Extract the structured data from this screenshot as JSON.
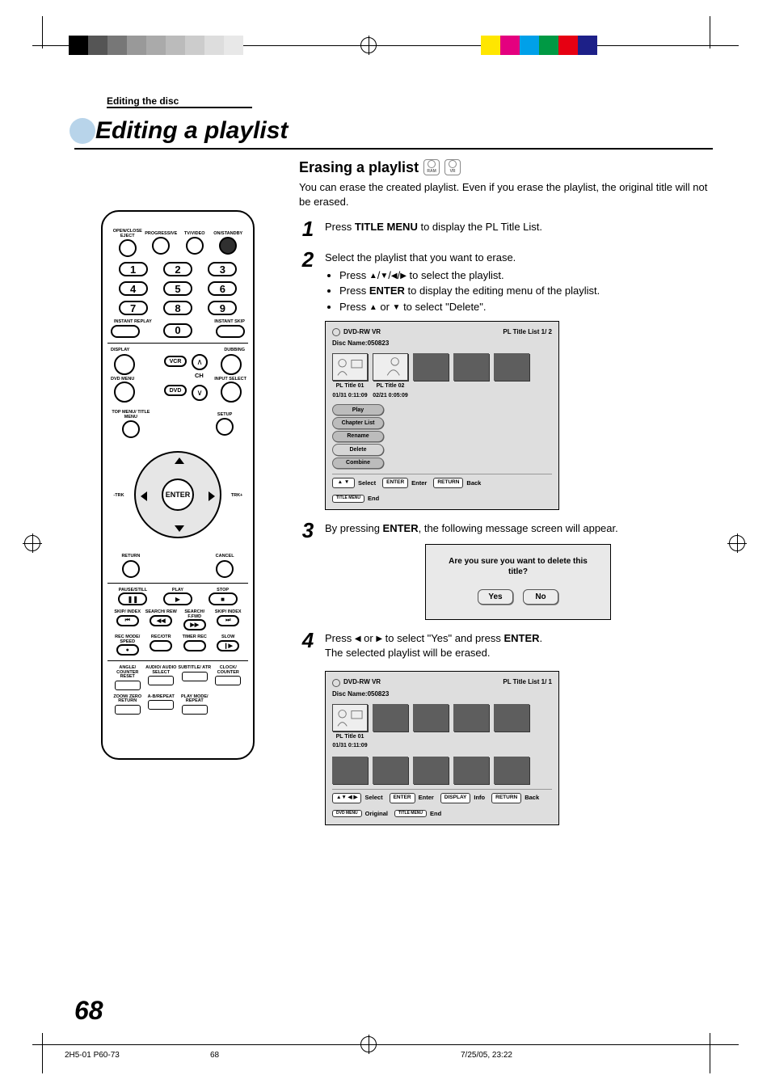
{
  "header": {
    "breadcrumb": "Editing the disc",
    "title": "Editing a playlist"
  },
  "section": {
    "heading": "Erasing a playlist",
    "badge1": "RAM",
    "badge2": "VR",
    "intro": "You can erase the created playlist. Even if you erase the playlist, the original title will not be erased."
  },
  "steps": {
    "s1": {
      "num": "1",
      "pre": "Press ",
      "bold": "TITLE MENU",
      "post": " to display the PL Title List."
    },
    "s2": {
      "num": "2",
      "line": "Select the playlist that you want to erase.",
      "b1_pre": "Press ",
      "b1_post": " to select the playlist.",
      "b2_pre": "Press ",
      "b2_bold": "ENTER",
      "b2_post": " to display the editing menu of the playlist.",
      "b3_pre": "Press ",
      "b3_mid": " or ",
      "b3_post": " to select \"Delete\"."
    },
    "s3": {
      "num": "3",
      "pre": "By pressing ",
      "bold": "ENTER",
      "post": ", the following message screen will appear."
    },
    "s4": {
      "num": "4",
      "pre": "Press ",
      "mid": " or ",
      "post1": " to select \"Yes\" and press ",
      "bold": "ENTER",
      "post2": ".",
      "line2": "The selected playlist will be erased."
    }
  },
  "panel1": {
    "format": "DVD-RW VR",
    "listinfo": "PL Title List  1/ 2",
    "discname_label": "Disc Name:",
    "discname": "050823",
    "titles": [
      {
        "name": "PL Title 01",
        "ts": "01/31 0:11:09"
      },
      {
        "name": "PL Title 02",
        "ts": "02/21 0:05:09"
      }
    ],
    "menu": [
      "Play",
      "Chapter List",
      "Rename",
      "Delete",
      "Combine"
    ],
    "legend": {
      "nav": "▲ ▼",
      "nav_lbl": "Select",
      "enter": "ENTER",
      "enter_lbl": "Enter",
      "return": "RETURN",
      "return_lbl": "Back",
      "title": "TITLE MENU",
      "title_lbl": "End"
    }
  },
  "dialog": {
    "msg": "Are you sure you want to delete this title?",
    "yes": "Yes",
    "no": "No"
  },
  "panel2": {
    "format": "DVD-RW VR",
    "listinfo": "PL Title List  1/ 1",
    "discname_label": "Disc Name:",
    "discname": "050823",
    "titles": [
      {
        "name": "PL Title 01",
        "ts": "01/31 0:11:09"
      }
    ],
    "legend": {
      "nav": "▲▼ ◀ ▶",
      "nav_lbl": "Select",
      "enter": "ENTER",
      "enter_lbl": "Enter",
      "display": "DISPLAY",
      "display_lbl": "Info",
      "return": "RETURN",
      "return_lbl": "Back",
      "dvd": "DVD MENU",
      "dvd_lbl": "Original",
      "title": "TITLE MENU",
      "title_lbl": "End"
    }
  },
  "remote": {
    "row1": [
      "OPEN/CLOSE EJECT",
      "PROGRESSIVE",
      "TV/VIDEO",
      "ON/STANDBY"
    ],
    "digits": [
      "1",
      "2",
      "3",
      "4",
      "5",
      "6",
      "7",
      "8",
      "9",
      "0"
    ],
    "instant_replay": "INSTANT REPLAY",
    "instant_skip": "INSTANT SKIP",
    "display": "DISPLAY",
    "dubbing": "DUBBING",
    "vcr": "VCR",
    "dvd": "DVD",
    "ch": "CH",
    "dvdmenu": "DVD MENU",
    "inputselect": "INPUT SELECT",
    "topmenu": "TOP MENU/ TITLE MENU",
    "setup": "SETUP",
    "enter": "ENTER",
    "trk_minus": "-TRK",
    "trk_plus": "TRK+",
    "return": "RETURN",
    "cancel": "CANCEL",
    "pause": "PAUSE/STILL",
    "play": "PLAY",
    "stop": "STOP",
    "skip_index_l": "SKIP/ INDEX",
    "search_rew": "SEARCH/ REW",
    "search_ffwd": "SEARCH/ F.FWD",
    "skip_index_r": "SKIP/ INDEX",
    "recmode": "REC MODE/ SPEED",
    "recotr": "REC/OTR",
    "timerrec": "TIMER REC",
    "slow": "SLOW",
    "angle": "ANGLE/ COUNTER RESET",
    "audio": "AUDIO/ AUDIO SELECT",
    "subtitle": "SUBTITLE/ ATR",
    "clock": "CLOCK/ COUNTER",
    "zoom": "ZOOM/ ZERO RETURN",
    "abrepeat": "A-B/REPEAT",
    "playmode": "PLAY MODE/ REPEAT"
  },
  "footer": {
    "page": "68",
    "file": "2H5-01 P60-73",
    "center": "68",
    "date": "7/25/05, 23:22"
  }
}
